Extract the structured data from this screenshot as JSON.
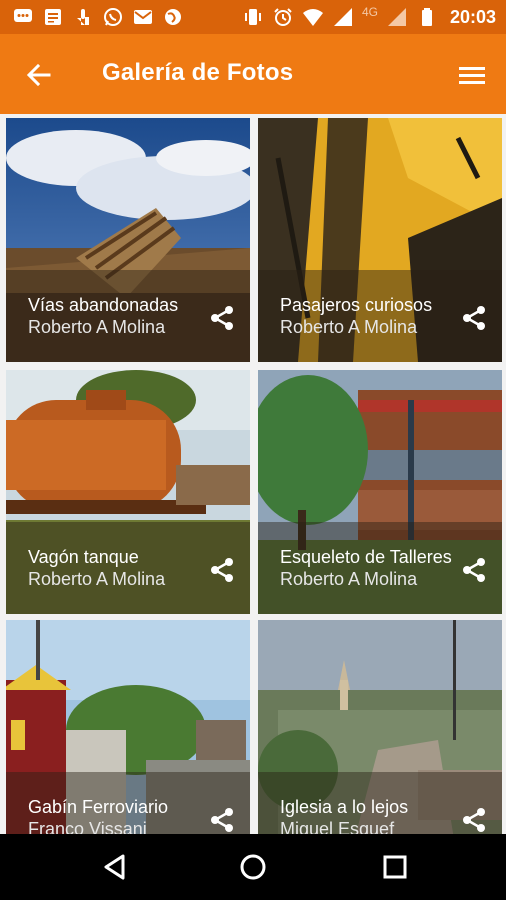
{
  "status_bar": {
    "time": "20:03",
    "network": "4G",
    "left_icons": [
      "chat-icon",
      "news-icon",
      "touch-icon",
      "whatsapp-icon",
      "gmail-icon",
      "globe-icon"
    ],
    "right_icons": [
      "vibrate-icon",
      "alarm-icon",
      "wifi-icon",
      "signal-icon",
      "battery-icon"
    ]
  },
  "app_bar": {
    "title": "Galería de Fotos",
    "back_icon": "arrow-back-icon",
    "menu_icon": "hamburger-menu-icon",
    "color": "#ef7a13"
  },
  "gallery": {
    "items": [
      {
        "title": "Vías abandonadas",
        "author": "Roberto A Molina"
      },
      {
        "title": "Pasajeros curiosos",
        "author": "Roberto A Molina"
      },
      {
        "title": "Vagón tanque",
        "author": "Roberto A Molina"
      },
      {
        "title": "Esqueleto de Talleres",
        "author": "Roberto A Molina"
      },
      {
        "title": "Gabín Ferroviario",
        "author": "Franco Vissani"
      },
      {
        "title": "Iglesia a lo lejos",
        "author": "Miguel Esquef"
      }
    ]
  },
  "nav_bar": {
    "icons": [
      "back-triangle-icon",
      "home-circle-icon",
      "recents-square-icon"
    ]
  }
}
